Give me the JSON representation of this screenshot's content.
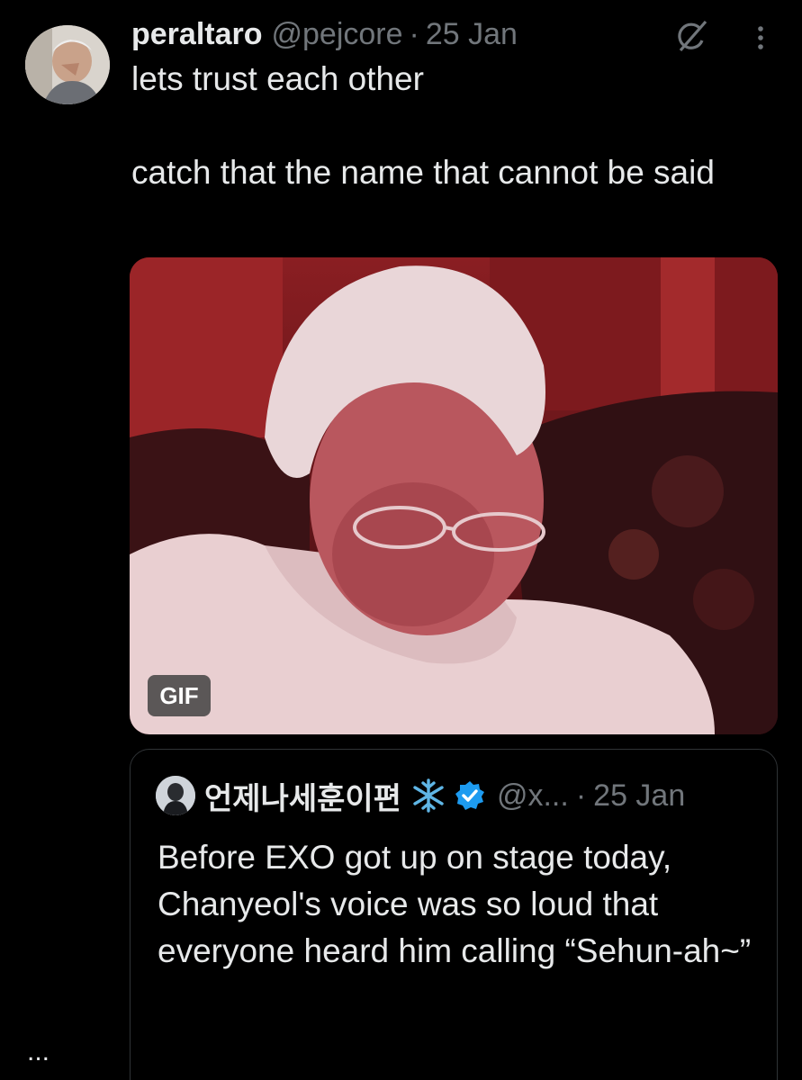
{
  "tweet": {
    "display_name": "peraltaro",
    "handle": "@pejcore",
    "separator": "·",
    "date": "25 Jan",
    "text_line1": "lets trust each other",
    "text_line2": "catch that the name that cannot be said",
    "media": {
      "badge": "GIF"
    },
    "icons": {
      "grok": "grok-icon",
      "more": "more-vertical-icon"
    }
  },
  "quote": {
    "display_name": "언제나세훈이편",
    "handle": "@x...",
    "separator": "·",
    "date": "25 Jan",
    "text": "Before EXO got up on stage today, Chanyeol's voice was so loud that everyone heard him calling “Sehun-ah~”",
    "ellipsis": "...",
    "icons": {
      "emoji": "snowflake-icon",
      "verified": "verified-badge-icon"
    },
    "colors": {
      "verified": "#1d9bf0",
      "snowflake": "#5fb6e6"
    }
  },
  "colors": {
    "background": "#000000",
    "text": "#e7e9ea",
    "muted": "#71767b",
    "border": "#2f3336"
  }
}
